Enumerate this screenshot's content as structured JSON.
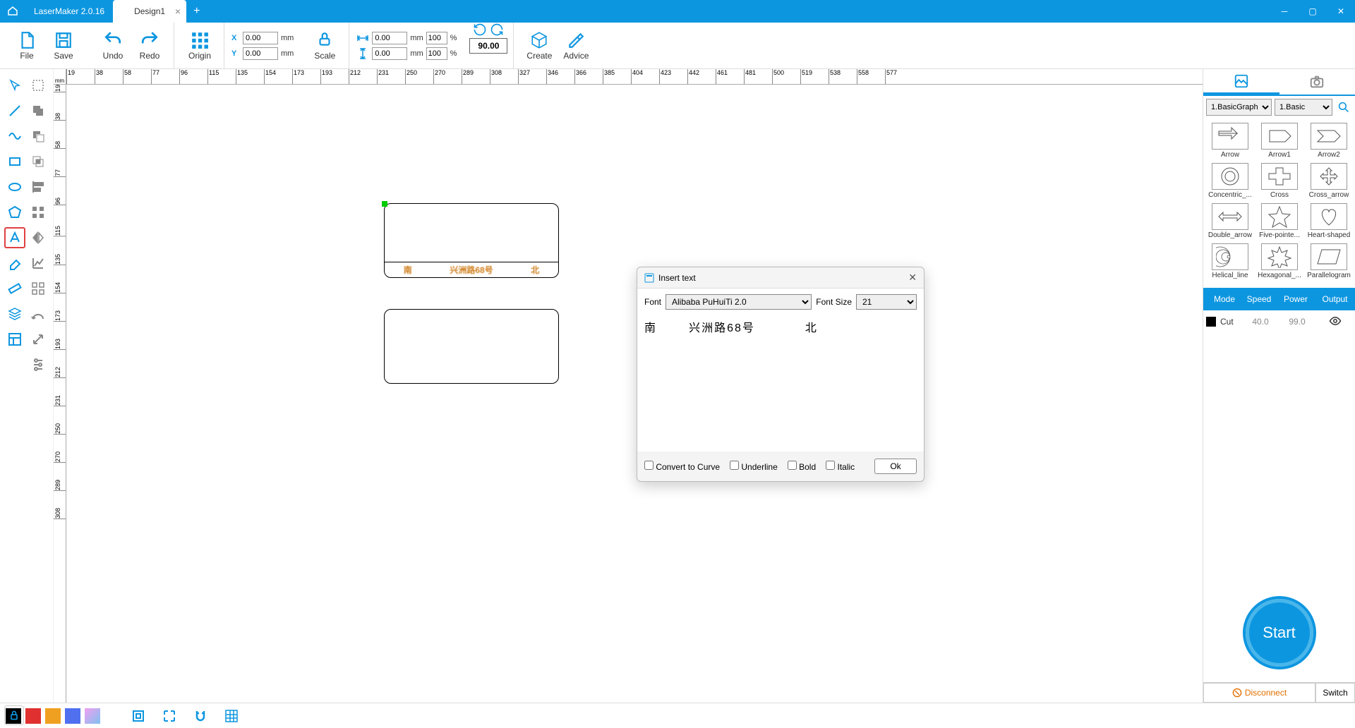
{
  "app": {
    "title": "LaserMaker 2.0.16",
    "tab_name": "Design1"
  },
  "toolbar": {
    "file": "File",
    "save": "Save",
    "undo": "Undo",
    "redo": "Redo",
    "origin": "Origin",
    "scale": "Scale",
    "create": "Create",
    "advice": "Advice",
    "x_label": "X",
    "y_label": "Y",
    "x_value": "0.00",
    "y_value": "0.00",
    "mm": "mm",
    "pct": "%",
    "w_value": "0.00",
    "h_value": "0.00",
    "w_pct": "100",
    "h_pct": "100",
    "rotate": "90.00"
  },
  "ruler": {
    "unit": "mm",
    "h": [
      "19",
      "38",
      "58",
      "77",
      "96",
      "115",
      "135",
      "154",
      "173",
      "193",
      "212",
      "231",
      "250",
      "270",
      "289",
      "308",
      "327",
      "346",
      "366",
      "385",
      "404",
      "423",
      "442",
      "461",
      "481",
      "500",
      "519",
      "538",
      "558",
      "577"
    ]
  },
  "right": {
    "cat1": "1.BasicGraph",
    "cat2": "1.Basic",
    "shapes": [
      {
        "name": "Arrow"
      },
      {
        "name": "Arrow1"
      },
      {
        "name": "Arrow2"
      },
      {
        "name": "Concentric_..."
      },
      {
        "name": "Cross"
      },
      {
        "name": "Cross_arrow"
      },
      {
        "name": "Double_arrow"
      },
      {
        "name": "Five-pointe..."
      },
      {
        "name": "Heart-shaped"
      },
      {
        "name": "Helical_line"
      },
      {
        "name": "Hexagonal_..."
      },
      {
        "name": "Parallelogram"
      }
    ],
    "headers": {
      "mode": "Mode",
      "speed": "Speed",
      "power": "Power",
      "output": "Output"
    },
    "layer": {
      "name": "Cut",
      "speed": "40.0",
      "power": "99.0"
    },
    "start": "Start",
    "disconnect": "Disconnect",
    "switch": "Switch"
  },
  "dialog": {
    "title": "Insert text",
    "font_label": "Font",
    "font_value": "Alibaba PuHuiTi 2.0",
    "size_label": "Font Size",
    "size_value": "21",
    "text": "南       兴洲路68号           北",
    "convert": "Convert to Curve",
    "underline": "Underline",
    "bold": "Bold",
    "italic": "Italic",
    "ok": "Ok"
  },
  "canvas": {
    "text_left": "南",
    "text_mid": "兴洲路68号",
    "text_right": "北"
  }
}
